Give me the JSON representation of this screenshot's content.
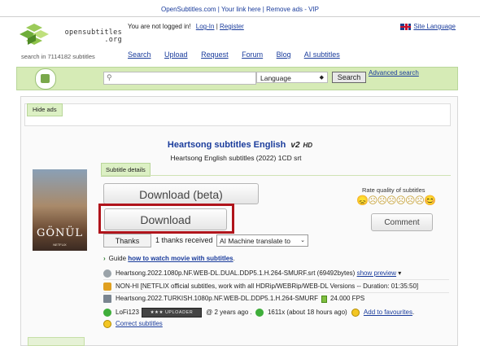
{
  "topbar": {
    "text": "OpenSubtitles.com | Your link here | Remove ads - VIP"
  },
  "logo": {
    "wordmark_line1": "opensubtitles",
    "wordmark_line2": ".org",
    "tagline": "search in 7114182 subtitles"
  },
  "header": {
    "login_status": "You are not logged in!",
    "login": "Log-In",
    "separator": "|",
    "register": "Register",
    "site_language": "Site Language"
  },
  "nav": [
    "Search",
    "Upload",
    "Request",
    "Forum",
    "Blog",
    "AI subtitles"
  ],
  "search": {
    "placeholder": "",
    "language_value": "Language",
    "search_button": "Search",
    "advanced": "Advanced search"
  },
  "ads": {
    "hide_ads": "Hide ads"
  },
  "subtitle": {
    "title": "Heartsong subtitles English",
    "version": "v2",
    "hd": "HD",
    "subtitle_line": "Heartsong English subtitles (2022) 1CD srt",
    "poster_title": "GÖNÜL",
    "poster_sub": "NETFLIX"
  },
  "details": {
    "tab": "Subtitle details",
    "download_beta": "Download (beta)",
    "download": "Download",
    "rate_label": "Rate quality of subtitles",
    "stars": "😞☹☹☹☹☹☹😊",
    "comment": "Comment",
    "thanks": "Thanks",
    "thanks_received": "1 thanks received",
    "ai_select": "AI Machine translate to"
  },
  "info": {
    "guide_prefix": "Guide",
    "guide_link": "how to watch movie with subtitles",
    "guide_suffix": ".",
    "file_name": "Heartsong.2022.1080p.NF.WEB-DL.DUAL.DDP5.1.H.264-SMURF.srt (69492bytes)",
    "show_preview": "show preview",
    "preview_arrow": "▾",
    "comment_text": "NON-HI [NETFLIX official subtitles, work with all HDRip/WEBRip/WEB-DL Versions -- Duration: 01:35:50]",
    "release_name": "Heartsong.2022.TURKISH.1080p.NF.WEB-DL.DDP5.1.H.264-SMURF",
    "fps": "24.000 FPS",
    "uploader": "LoFi123",
    "uploader_badge": "★★★ UPLOADER",
    "age": "@ 2 years ago .",
    "downloads": "1611x (about 18 hours ago)",
    "favourites": "Add to favourites",
    "favourites_suffix": ".",
    "correct": "Correct subtitles"
  },
  "colors": {
    "link": "#1a3c9c",
    "green_bar": "#d6ebb6",
    "highlight": "#b0141b"
  }
}
